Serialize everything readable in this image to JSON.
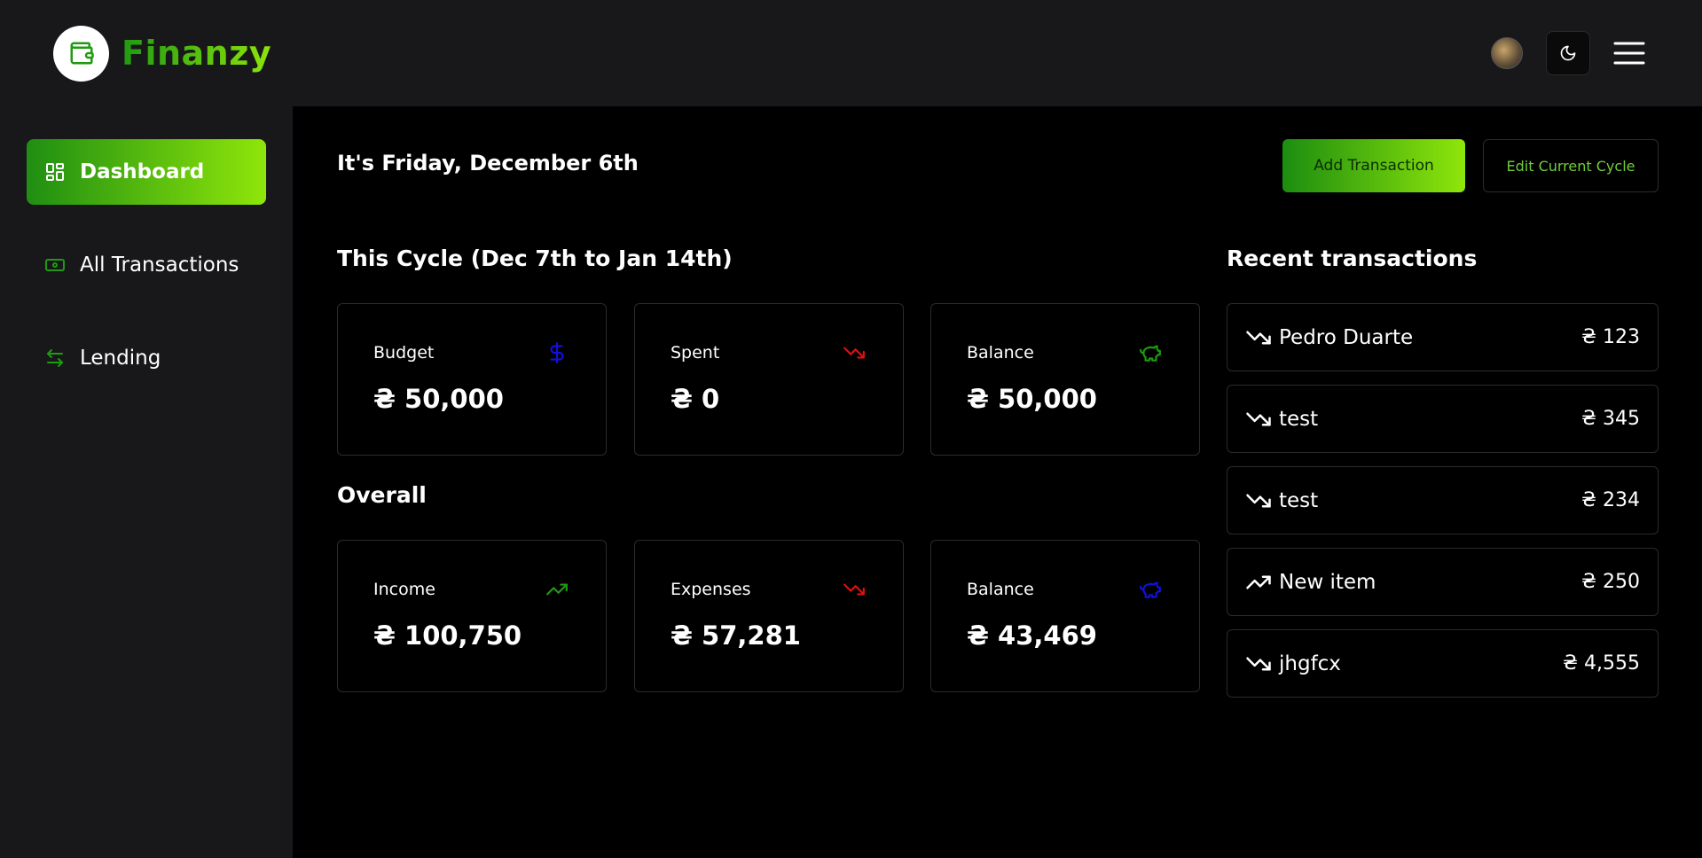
{
  "app": {
    "name": "Finanzy"
  },
  "header": {
    "theme_icon": "moon-icon",
    "menu_icon": "hamburger-menu-icon"
  },
  "sidebar": {
    "items": [
      {
        "label": "Dashboard",
        "icon": "dashboard-grid-icon",
        "active": true
      },
      {
        "label": "All Transactions",
        "icon": "banknote-icon",
        "active": false
      },
      {
        "label": "Lending",
        "icon": "arrows-left-right-icon",
        "active": false
      }
    ]
  },
  "main": {
    "date_title": "It's Friday, December 6th",
    "add_transaction_label": "Add Transaction",
    "edit_cycle_label": "Edit Current Cycle",
    "cycle": {
      "title": "This Cycle (Dec 7th to Jan 14th)",
      "cards": [
        {
          "label": "Budget",
          "value": "₴ 50,000",
          "icon": "dollar-icon",
          "icon_color": "#1010e0"
        },
        {
          "label": "Spent",
          "value": "₴ 0",
          "icon": "trending-down-icon",
          "icon_color": "#e01010"
        },
        {
          "label": "Balance",
          "value": "₴ 50,000",
          "icon": "piggy-bank-icon",
          "icon_color": "#1f9a11"
        }
      ]
    },
    "overall": {
      "title": "Overall",
      "cards": [
        {
          "label": "Income",
          "value": "₴ 100,750",
          "icon": "trending-up-icon",
          "icon_color": "#1f9a11"
        },
        {
          "label": "Expenses",
          "value": "₴ 57,281",
          "icon": "trending-down-icon",
          "icon_color": "#e01010"
        },
        {
          "label": "Balance",
          "value": "₴ 43,469",
          "icon": "piggy-bank-icon",
          "icon_color": "#1010e0"
        }
      ]
    },
    "recent": {
      "title": "Recent transactions",
      "items": [
        {
          "name": "Pedro Duarte",
          "amount": "₴ 123",
          "icon": "trending-down-icon"
        },
        {
          "name": "test",
          "amount": "₴ 345",
          "icon": "trending-down-icon"
        },
        {
          "name": "test",
          "amount": "₴ 234",
          "icon": "trending-down-icon"
        },
        {
          "name": "New item",
          "amount": "₴ 250",
          "icon": "trending-up-icon"
        },
        {
          "name": "jhgfcx",
          "amount": "₴ 4,555",
          "icon": "trending-down-icon"
        }
      ]
    }
  },
  "colors": {
    "accent_start": "#1f9a11",
    "accent_end": "#8de40b",
    "panel": "#18181b",
    "background": "#000000"
  }
}
